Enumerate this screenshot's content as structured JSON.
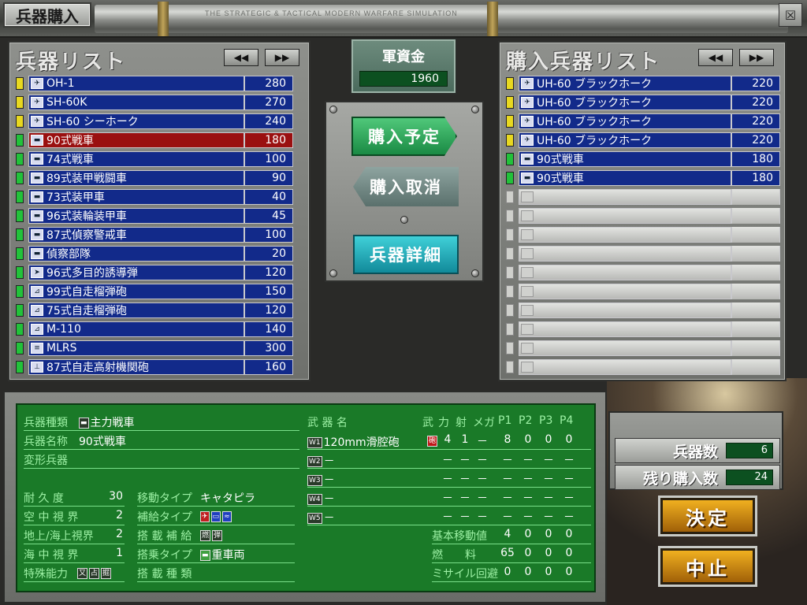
{
  "header": {
    "title": "兵器購入",
    "subtitle": "THE STRATEGIC & TACTICAL MODERN WARFARE SIMULATION",
    "close_label": "☒"
  },
  "funds": {
    "label": "軍資金",
    "value": "1960"
  },
  "weapon_list": {
    "title": "兵器リスト",
    "prev_label": "◀◀",
    "next_label": "▶▶",
    "items": [
      {
        "name": "OH-1",
        "price": "280",
        "indicator": "yellow",
        "icon": "helicopter-icon",
        "selected": false
      },
      {
        "name": "SH-60K",
        "price": "270",
        "indicator": "yellow",
        "icon": "helicopter-icon",
        "selected": false
      },
      {
        "name": "SH-60 シーホーク",
        "price": "240",
        "indicator": "yellow",
        "icon": "helicopter-icon",
        "selected": false
      },
      {
        "name": "90式戦車",
        "price": "180",
        "indicator": "green",
        "icon": "tank-icon",
        "selected": true
      },
      {
        "name": "74式戦車",
        "price": "100",
        "indicator": "green",
        "icon": "tank-icon",
        "selected": false
      },
      {
        "name": "89式装甲戦闘車",
        "price": "90",
        "indicator": "green",
        "icon": "tank-icon",
        "selected": false
      },
      {
        "name": "73式装甲車",
        "price": "40",
        "indicator": "green",
        "icon": "tank-icon",
        "selected": false
      },
      {
        "name": "96式装輪装甲車",
        "price": "45",
        "indicator": "green",
        "icon": "tank-icon",
        "selected": false
      },
      {
        "name": "87式偵察警戒車",
        "price": "100",
        "indicator": "green",
        "icon": "tank-icon",
        "selected": false
      },
      {
        "name": "偵察部隊",
        "price": "20",
        "indicator": "green",
        "icon": "tank-icon",
        "selected": false
      },
      {
        "name": "96式多目的誘導弾",
        "price": "120",
        "indicator": "green",
        "icon": "missile-icon",
        "selected": false
      },
      {
        "name": "99式自走榴弾砲",
        "price": "150",
        "indicator": "green",
        "icon": "artillery-icon",
        "selected": false
      },
      {
        "name": "75式自走榴弾砲",
        "price": "120",
        "indicator": "green",
        "icon": "artillery-icon",
        "selected": false
      },
      {
        "name": "M-110",
        "price": "140",
        "indicator": "green",
        "icon": "artillery-icon",
        "selected": false
      },
      {
        "name": "MLRS",
        "price": "300",
        "indicator": "green",
        "icon": "rocket-icon",
        "selected": false
      },
      {
        "name": "87式自走高射機関砲",
        "price": "160",
        "indicator": "green",
        "icon": "aa-gun-icon",
        "selected": false
      }
    ]
  },
  "purchase_list": {
    "title": "購入兵器リスト",
    "prev_label": "◀◀",
    "next_label": "▶▶",
    "items": [
      {
        "name": "UH-60 ブラックホーク",
        "price": "220",
        "indicator": "yellow",
        "icon": "helicopter-icon"
      },
      {
        "name": "UH-60 ブラックホーク",
        "price": "220",
        "indicator": "yellow",
        "icon": "helicopter-icon"
      },
      {
        "name": "UH-60 ブラックホーク",
        "price": "220",
        "indicator": "yellow",
        "icon": "helicopter-icon"
      },
      {
        "name": "UH-60 ブラックホーク",
        "price": "220",
        "indicator": "yellow",
        "icon": "helicopter-icon"
      },
      {
        "name": "90式戦車",
        "price": "180",
        "indicator": "green",
        "icon": "tank-icon"
      },
      {
        "name": "90式戦車",
        "price": "180",
        "indicator": "green",
        "icon": "tank-icon"
      },
      {
        "name": "",
        "price": "",
        "indicator": "empty",
        "icon": ""
      },
      {
        "name": "",
        "price": "",
        "indicator": "empty",
        "icon": ""
      },
      {
        "name": "",
        "price": "",
        "indicator": "empty",
        "icon": ""
      },
      {
        "name": "",
        "price": "",
        "indicator": "empty",
        "icon": ""
      },
      {
        "name": "",
        "price": "",
        "indicator": "empty",
        "icon": ""
      },
      {
        "name": "",
        "price": "",
        "indicator": "empty",
        "icon": ""
      },
      {
        "name": "",
        "price": "",
        "indicator": "empty",
        "icon": ""
      },
      {
        "name": "",
        "price": "",
        "indicator": "empty",
        "icon": ""
      },
      {
        "name": "",
        "price": "",
        "indicator": "empty",
        "icon": ""
      },
      {
        "name": "",
        "price": "",
        "indicator": "empty",
        "icon": ""
      }
    ]
  },
  "actions": {
    "buy_label": "購入予定",
    "cancel_label": "購入取消",
    "detail_label": "兵器詳細"
  },
  "details": {
    "type_label": "兵器種類",
    "type_value": "主力戦車",
    "name_label": "兵器名称",
    "name_value": "90式戦車",
    "transform_label": "変形兵器",
    "durability_label": "耐 久 度",
    "durability_value": "30",
    "air_view_label": "空 中 視 界",
    "air_view_value": "2",
    "ground_view_label": "地上/海上視界",
    "ground_view_value": "2",
    "sea_view_label": "海 中 視 界",
    "sea_view_value": "1",
    "special_label": "特殊能力",
    "special_tags": [
      "又",
      "占",
      "掘"
    ],
    "move_type_label": "移動タイプ",
    "move_type_value": "キャタピラ",
    "supply_type_label": "補給タイプ",
    "onboard_supply_label": "搭 載 補 給",
    "onboard_supply_tags": [
      "燃",
      "弾"
    ],
    "ride_type_label": "搭乗タイプ",
    "ride_type_value": "重車両",
    "cargo_label": "搭 載 種 類"
  },
  "weapons_table": {
    "header_name": "武 器 名",
    "headers": [
      "武",
      "力",
      "射",
      "メガ",
      "P1",
      "P2",
      "P3",
      "P4"
    ],
    "rows": [
      {
        "slot": "W1",
        "name": "120mm滑腔砲",
        "wtag": "砲",
        "vals": [
          "4",
          "1",
          "－",
          "8",
          "0",
          "0",
          "0"
        ]
      },
      {
        "slot": "W2",
        "name": "－",
        "wtag": "",
        "vals": [
          "－",
          "－",
          "－",
          "－",
          "－",
          "－",
          "－"
        ]
      },
      {
        "slot": "W3",
        "name": "－",
        "wtag": "",
        "vals": [
          "－",
          "－",
          "－",
          "－",
          "－",
          "－",
          "－"
        ]
      },
      {
        "slot": "W4",
        "name": "－",
        "wtag": "",
        "vals": [
          "－",
          "－",
          "－",
          "－",
          "－",
          "－",
          "－"
        ]
      },
      {
        "slot": "W5",
        "name": "－",
        "wtag": "",
        "vals": [
          "－",
          "－",
          "－",
          "－",
          "－",
          "－",
          "－"
        ]
      }
    ],
    "stats": [
      {
        "label": "基本移動値",
        "vals": [
          "4",
          "0",
          "0",
          "0"
        ]
      },
      {
        "label": "燃　　料",
        "vals": [
          "65",
          "0",
          "0",
          "0"
        ]
      },
      {
        "label": "ミサイル回避",
        "vals": [
          "0",
          "0",
          "0",
          "0"
        ]
      }
    ]
  },
  "counts": {
    "weapon_count_label": "兵器数",
    "weapon_count_value": "6",
    "remaining_label": "残り購入数",
    "remaining_value": "24"
  },
  "decide_label": "決定",
  "abort_label": "中止"
}
